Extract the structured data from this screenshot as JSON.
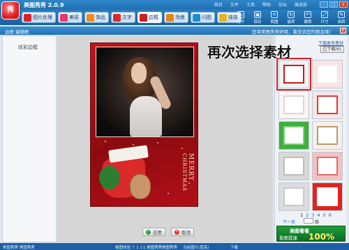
{
  "app": {
    "title": "美图秀秀 2.0.9",
    "logo_text": "秀",
    "menu": [
      "首页",
      "文件",
      "工具",
      "帮助",
      "论坛",
      "换皮肤"
    ],
    "window_buttons": [
      "-",
      "□",
      "x"
    ]
  },
  "tabs": [
    {
      "label": "图片处理",
      "color": "#d8242c"
    },
    {
      "label": "美容",
      "color": "#e4386f"
    },
    {
      "label": "饰品",
      "color": "#f08b1b"
    },
    {
      "label": "文字",
      "color": "#d12d2d"
    },
    {
      "label": "边框",
      "color": "#c81f1f",
      "active": true
    },
    {
      "label": "场景",
      "color": "#e0861c"
    },
    {
      "label": "闪图",
      "color": "#1a8fd0"
    },
    {
      "label": "娃娃",
      "color": "#e3b41c"
    }
  ],
  "tools": [
    {
      "label": "打开",
      "icon": "folder-icon"
    },
    {
      "label": "保存",
      "icon": "save-icon"
    },
    {
      "label": "剪图",
      "icon": "crop-icon"
    },
    {
      "label": "旋转",
      "icon": "rotate-icon"
    },
    {
      "label": "撤销",
      "icon": "undo-icon"
    },
    {
      "label": "尺寸",
      "icon": "resize-icon"
    },
    {
      "label": "涂鸦",
      "icon": "pen-icon"
    }
  ],
  "subbar": {
    "crumb": "边框  编辑框",
    "tip": "您将美图秀秀好用，看告诉您的朋友哦！",
    "close": "x"
  },
  "left_panel": {
    "title": "炫彩边框"
  },
  "overlay_caption": "再次选择素材",
  "canvas": {
    "merry_line1": "MERRY",
    "merry_line2": "CHRISTMAS",
    "apply_label": "应用",
    "cancel_label": "取消"
  },
  "right_panel": {
    "more_link": "下载更多素材",
    "download_button": "已下载(6)",
    "thumbnails": [
      {
        "bg": "#f1f1f1",
        "frame": "#c51820",
        "selected": true
      },
      {
        "bg": "#fbe3e3",
        "frame": "#f0f0f0"
      },
      {
        "bg": "#fdf4f4",
        "frame": "#d7d7d7"
      },
      {
        "bg": "#f6e7e7",
        "frame": "#d93b3b"
      },
      {
        "bg": "#3fae3f",
        "frame": "#7fd07f"
      },
      {
        "bg": "#f4f0ea",
        "frame": "#b99c6b"
      },
      {
        "bg": "#d9d9d9",
        "frame": "#bdbdbd"
      },
      {
        "bg": "#f3c1c1",
        "frame": "#e36a6a"
      },
      {
        "bg": "#dcdcdc",
        "frame": "#c9c9c9"
      },
      {
        "bg": "#e1231d",
        "frame": "#ffffff"
      }
    ],
    "pages": [
      "1",
      "2",
      "3",
      "4",
      "5",
      "6"
    ],
    "current_page": "1",
    "next_page": "下一页",
    "jump_label": "跳",
    "ad_line1": "美图看看",
    "ad_line2": "看图提速",
    "ad_line3": "100%"
  },
  "status_bar": {
    "left": "美图秀秀   美图秀秀",
    "mid1": "看图体验 ↑ 1  ↓1  美图秀秀",
    "mid2": "美图秀秀",
    "right": "当前图片(宽高)",
    "right2": "下载"
  }
}
